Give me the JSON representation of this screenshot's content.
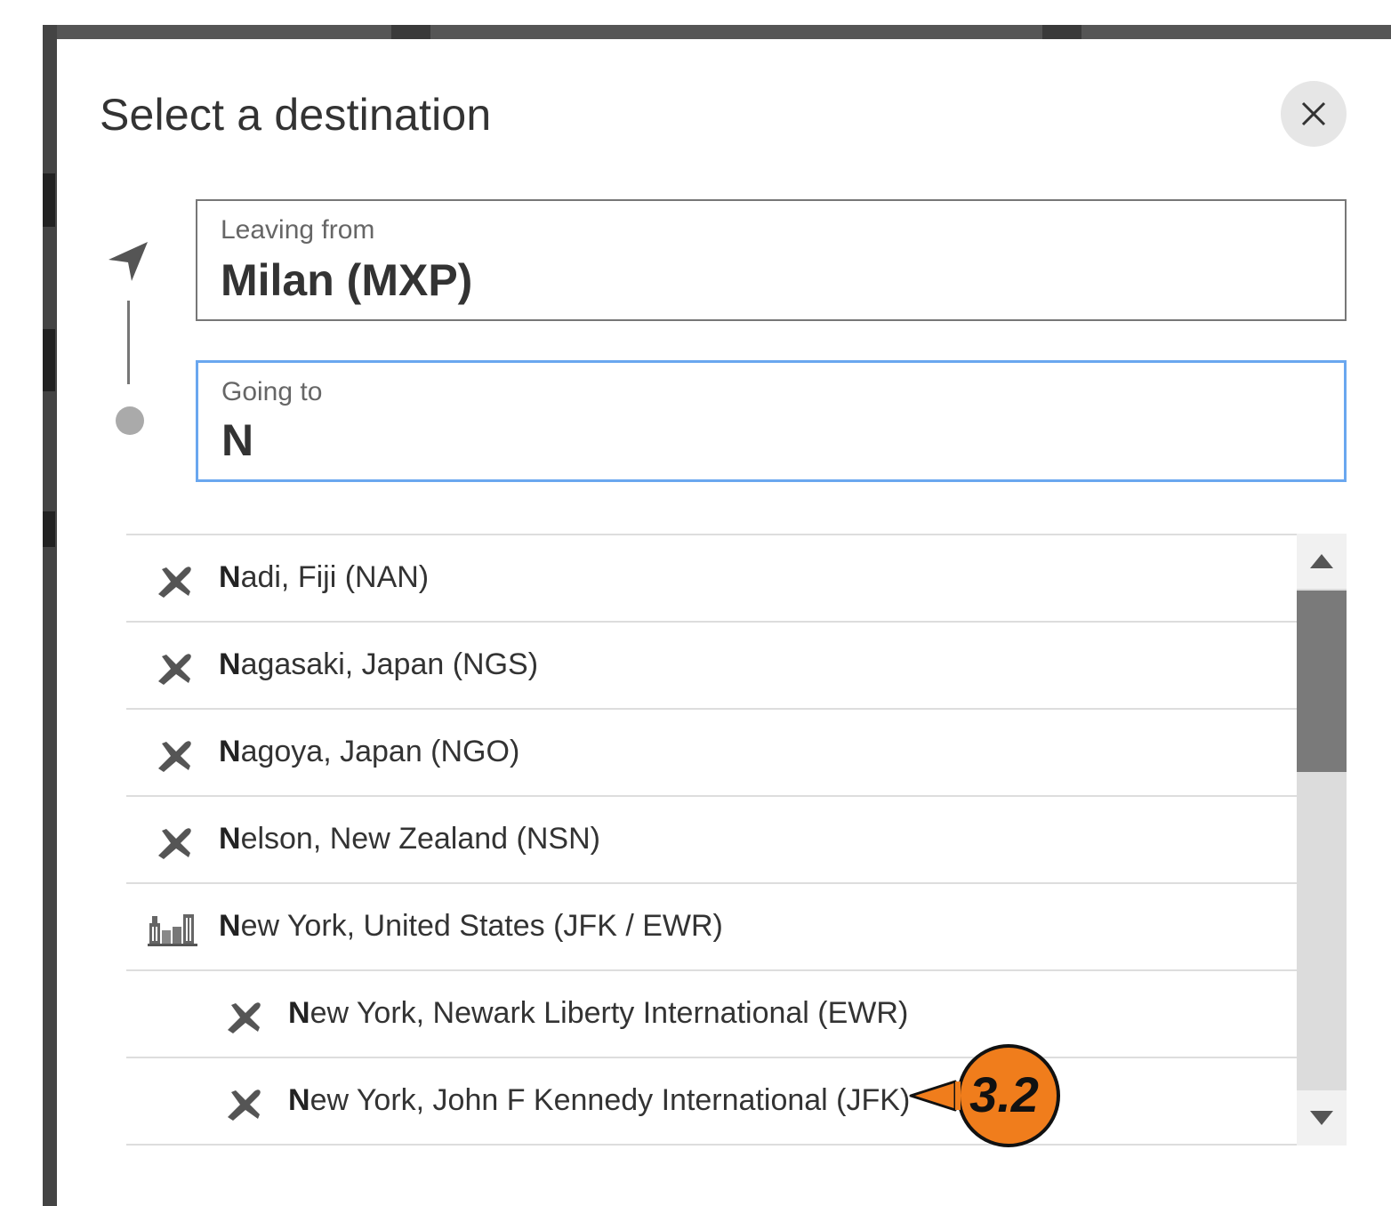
{
  "dialog": {
    "title": "Select a destination",
    "close_icon": "close-icon"
  },
  "route": {
    "origin_icon": "navigation-arrow-icon",
    "destination_icon": "destination-dot-icon"
  },
  "leaving_from": {
    "label": "Leaving from",
    "value": "Milan (MXP)"
  },
  "going_to": {
    "label": "Going to",
    "value": "N"
  },
  "suggestions": [
    {
      "icon": "airplane-icon",
      "match": "N",
      "rest": "adi, Fiji (NAN)"
    },
    {
      "icon": "airplane-icon",
      "match": "N",
      "rest": "agasaki, Japan (NGS)"
    },
    {
      "icon": "airplane-icon",
      "match": "N",
      "rest": "agoya, Japan (NGO)"
    },
    {
      "icon": "airplane-icon",
      "match": "N",
      "rest": "elson, New Zealand (NSN)"
    },
    {
      "icon": "city-icon",
      "match": "N",
      "rest": "ew York, United States (JFK / EWR)"
    },
    {
      "icon": "airplane-icon",
      "match": "N",
      "rest": "ew York, Newark Liberty International (EWR)"
    },
    {
      "icon": "airplane-icon",
      "match": "N",
      "rest": "ew York, John F Kennedy International (JFK)"
    }
  ],
  "scrollbar": {
    "up_icon": "arrow-up-icon",
    "down_icon": "arrow-down-icon"
  },
  "annotation": {
    "label": "3.2",
    "color": "#f07d1c"
  }
}
